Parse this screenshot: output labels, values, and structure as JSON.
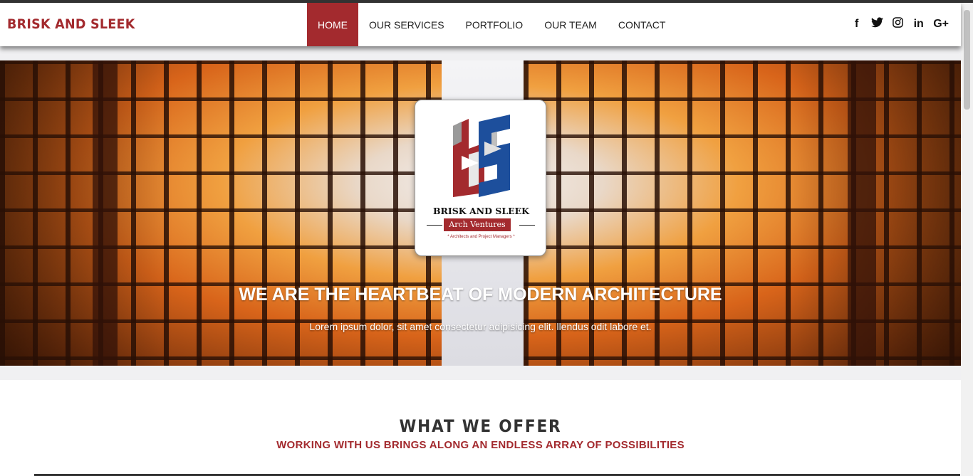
{
  "brand": "BRISK AND SLEEK",
  "nav": {
    "items": [
      {
        "label": "HOME",
        "active": true
      },
      {
        "label": "OUR SERVICES",
        "active": false
      },
      {
        "label": "PORTFOLIO",
        "active": false
      },
      {
        "label": "OUR TEAM",
        "active": false
      },
      {
        "label": "CONTACT",
        "active": false
      }
    ]
  },
  "social": [
    {
      "icon": "facebook-icon",
      "glyph": "f"
    },
    {
      "icon": "twitter-icon",
      "glyph": "🐦"
    },
    {
      "icon": "instagram-icon",
      "glyph": "◎"
    },
    {
      "icon": "linkedin-icon",
      "glyph": "in"
    },
    {
      "icon": "google-plus-icon",
      "glyph": "G+"
    }
  ],
  "hero": {
    "logo": {
      "name": "BRISK AND SLEEK",
      "subtitle": "Arch Ventures",
      "tagline": "* Architects and Project Managers *"
    },
    "title": "WE ARE THE HEARTBEAT OF MODERN ARCHITECTURE",
    "subtitle": "Lorem ipsum dolor, sit amet consectetur adipisicing elit. llendus odit labore et."
  },
  "offer": {
    "title": "WHAT WE OFFER",
    "subtitle": "WORKING WITH US BRINGS ALONG AN ENDLESS ARRAY OF POSSIBILITIES"
  },
  "colors": {
    "brand_red": "#a32a2e",
    "logo_blue": "#1d4f9c"
  }
}
